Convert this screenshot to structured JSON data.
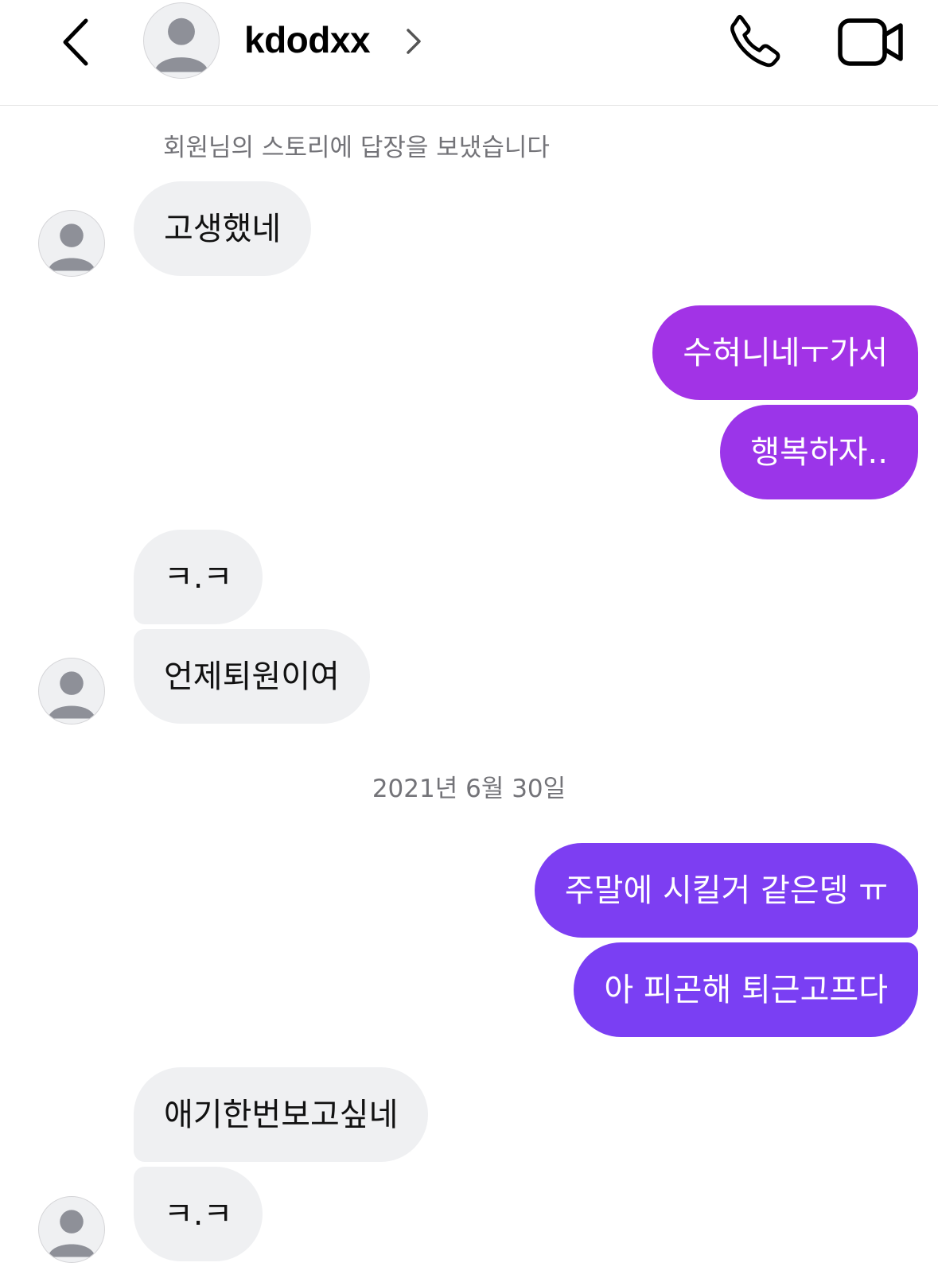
{
  "header": {
    "username": "kdodxx",
    "back_icon": "chevron-left-icon",
    "profile_chevron_icon": "chevron-right-icon",
    "call_icon": "phone-icon",
    "video_icon": "video-camera-icon"
  },
  "system_notice": "회원님의 스토리에 답장을 보냈습니다",
  "date_separator": "2021년 6월 30일",
  "colors": {
    "incoming_bubble": "#eff0f2",
    "outgoing_bubble_top": "#a233e6",
    "outgoing_bubble_bottom": "#7b3ff2",
    "meta_text": "#737378"
  },
  "messages": [
    {
      "direction": "incoming",
      "text": "고생했네"
    },
    {
      "direction": "outgoing",
      "text": "수혀니네ㅜ가서"
    },
    {
      "direction": "outgoing",
      "text": "행복하자.."
    },
    {
      "direction": "incoming",
      "text": "ㅋ.ㅋ"
    },
    {
      "direction": "incoming",
      "text": "언제퇴원이여"
    },
    {
      "direction": "outgoing",
      "text": "주말에 시킬거 같은뎅 ㅠ"
    },
    {
      "direction": "outgoing",
      "text": "아 피곤해 퇴근고프다"
    },
    {
      "direction": "incoming",
      "text": "애기한번보고싶네"
    },
    {
      "direction": "incoming",
      "text": "ㅋ.ㅋ"
    }
  ]
}
